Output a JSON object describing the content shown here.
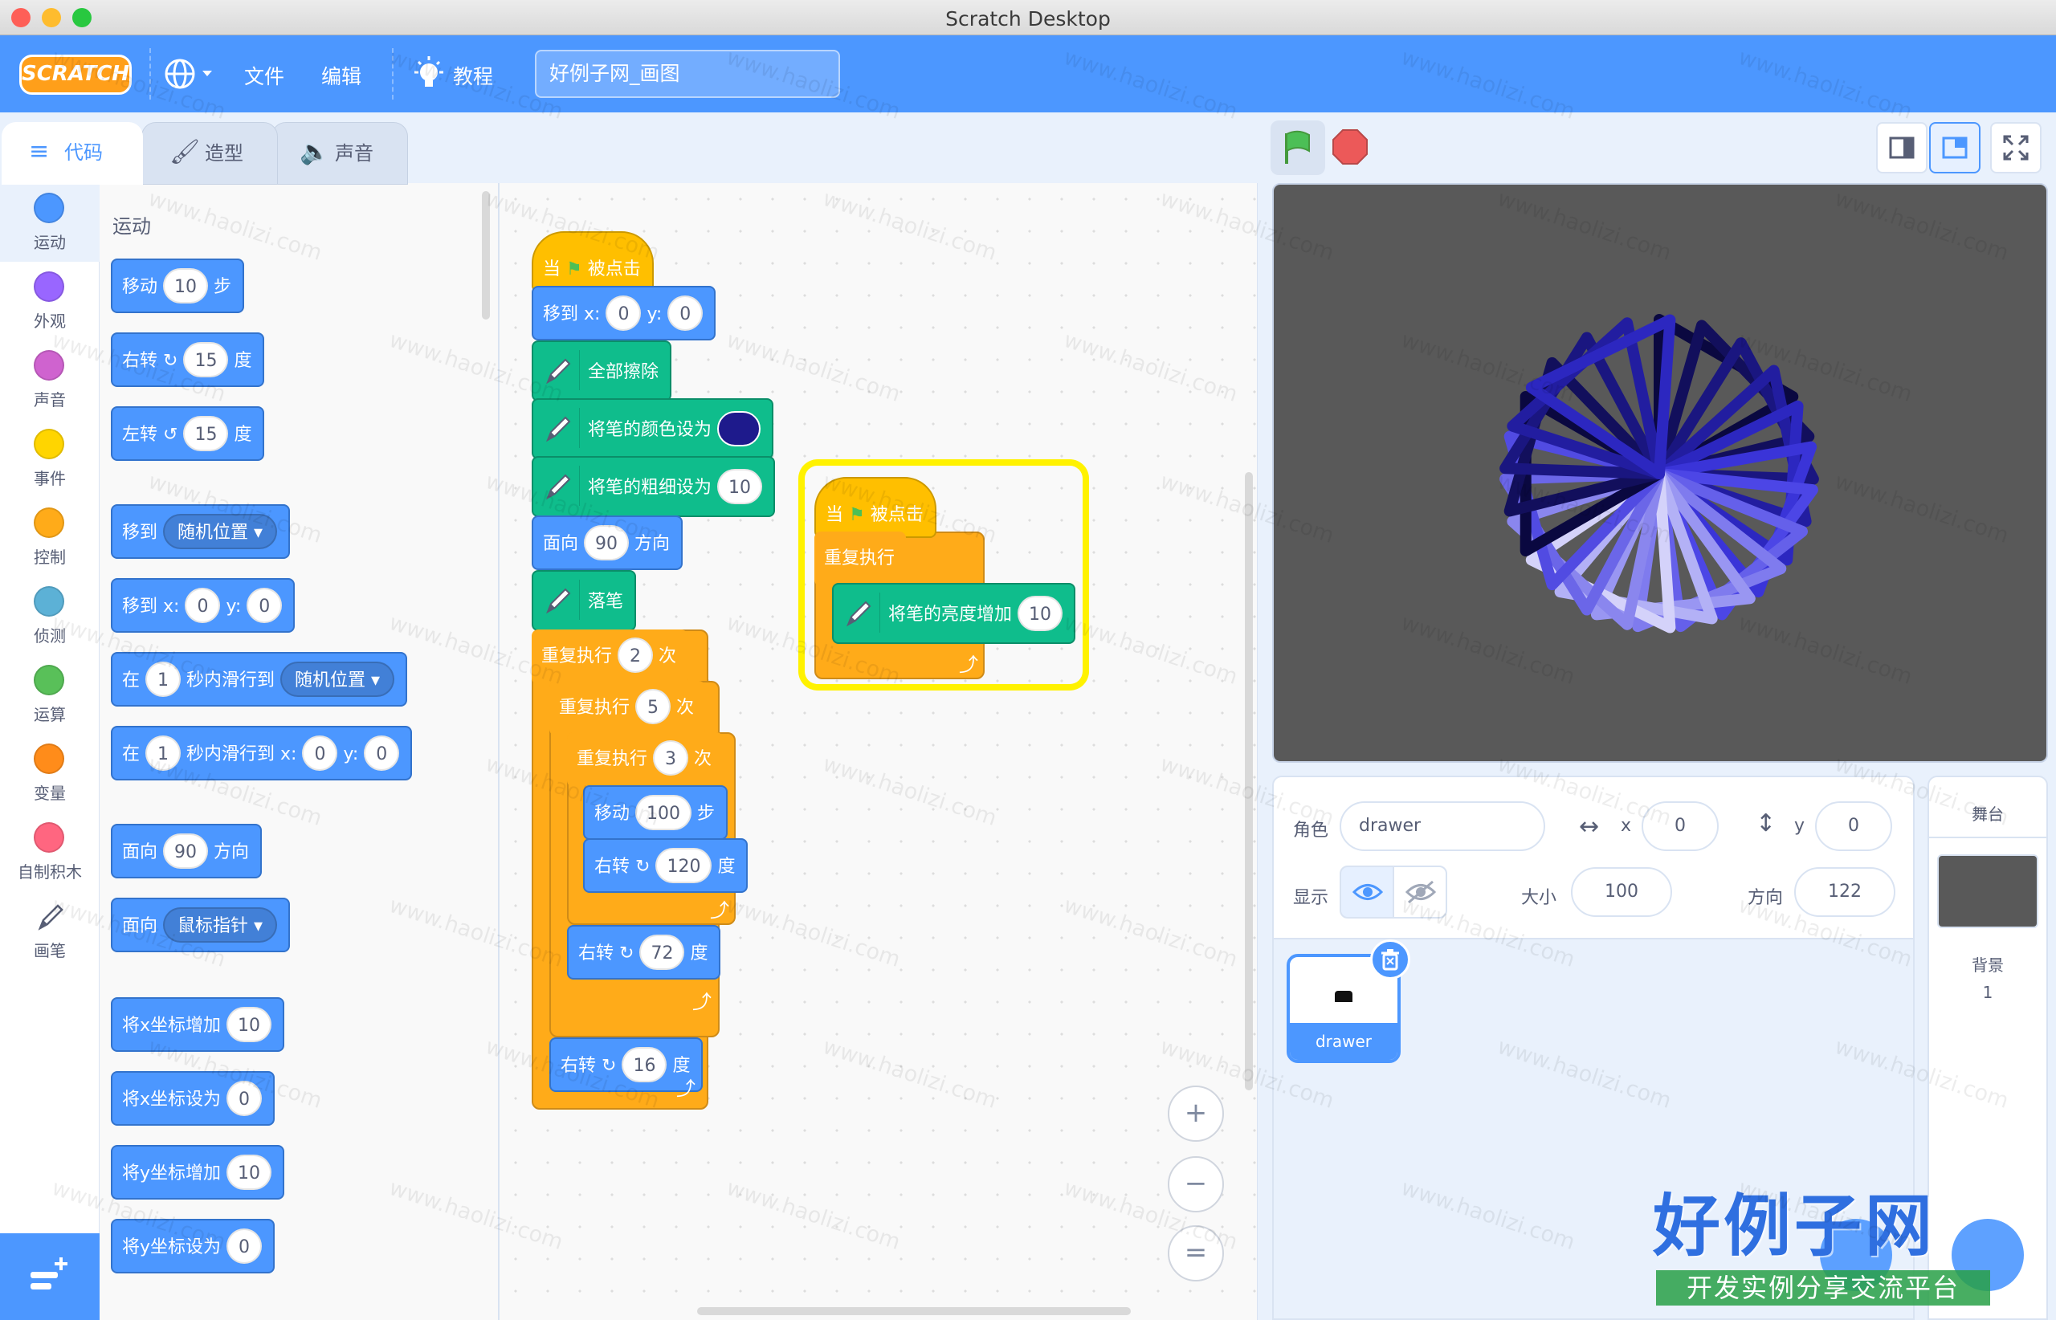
{
  "window_title": "Scratch Desktop",
  "menu": {
    "logo": "SCRATCH",
    "file": "文件",
    "edit": "编辑",
    "tutorials": "教程",
    "project_title": "好例子网_画图"
  },
  "tabs": {
    "code": "代码",
    "costumes": "造型",
    "sounds": "声音"
  },
  "categories": [
    {
      "label": "运动",
      "color": "#4c97ff"
    },
    {
      "label": "外观",
      "color": "#9966ff"
    },
    {
      "label": "声音",
      "color": "#cf63cf"
    },
    {
      "label": "事件",
      "color": "#ffd500"
    },
    {
      "label": "控制",
      "color": "#ffab19"
    },
    {
      "label": "侦测",
      "color": "#5cb1d6"
    },
    {
      "label": "运算",
      "color": "#59c059"
    },
    {
      "label": "变量",
      "color": "#ff8c1a"
    },
    {
      "label": "自制积木",
      "color": "#ff6680"
    },
    {
      "label": "画笔",
      "color": "#0fbd8c"
    }
  ],
  "palette": {
    "heading": "运动",
    "move": {
      "a": "移动",
      "v": "10",
      "b": "步"
    },
    "turn_right": {
      "a": "右转",
      "v": "15",
      "b": "度"
    },
    "turn_left": {
      "a": "左转",
      "v": "15",
      "b": "度"
    },
    "goto": {
      "a": "移到",
      "d": "随机位置"
    },
    "goto_xy": {
      "a": "移到 x:",
      "x": "0",
      "y_lbl": "y:",
      "y": "0"
    },
    "glide": {
      "a": "在",
      "v": "1",
      "b": "秒内滑行到",
      "d": "随机位置"
    },
    "glide_xy": {
      "a": "在",
      "v": "1",
      "b": "秒内滑行到 x:",
      "x": "0",
      "y_lbl": "y:",
      "y": "0"
    },
    "point_dir": {
      "a": "面向",
      "v": "90",
      "b": "方向"
    },
    "point_to": {
      "a": "面向",
      "d": "鼠标指针"
    },
    "change_x": {
      "a": "将x坐标增加",
      "v": "10"
    },
    "set_x": {
      "a": "将x坐标设为",
      "v": "0"
    },
    "change_y": {
      "a": "将y坐标增加",
      "v": "10"
    },
    "set_y": {
      "a": "将y坐标设为",
      "v": "0"
    }
  },
  "script1": {
    "hat": {
      "a": "当",
      "b": "被点击"
    },
    "goto": {
      "a": "移到 x:",
      "x": "0",
      "y_lbl": "y:",
      "y": "0"
    },
    "clear": "全部擦除",
    "set_color": {
      "a": "将笔的颜色设为",
      "color": "#1e1a8c"
    },
    "set_size": {
      "a": "将笔的粗细设为",
      "v": "10"
    },
    "face": {
      "a": "面向",
      "v": "90",
      "b": "方向"
    },
    "pen_down": "落笔",
    "rep1": {
      "a": "重复执行",
      "v": "2",
      "b": "次"
    },
    "rep2": {
      "a": "重复执行",
      "v": "5",
      "b": "次"
    },
    "rep3": {
      "a": "重复执行",
      "v": "3",
      "b": "次"
    },
    "move": {
      "a": "移动",
      "v": "100",
      "b": "步"
    },
    "turn1": {
      "a": "右转",
      "v": "120",
      "b": "度"
    },
    "turn2": {
      "a": "右转",
      "v": "72",
      "b": "度"
    },
    "turn3": {
      "a": "右转",
      "v": "16",
      "b": "度"
    }
  },
  "script2": {
    "hat": {
      "a": "当",
      "b": "被点击"
    },
    "forever": "重复执行",
    "change_bright": {
      "a": "将笔的亮度增加",
      "v": "10"
    }
  },
  "zoom": {
    "in": "+",
    "out": "−",
    "reset": "="
  },
  "sprite_info": {
    "sprite_label": "角色",
    "sprite_name": "drawer",
    "x_label": "x",
    "x": "0",
    "y_label": "y",
    "y": "0",
    "show_label": "显示",
    "size_label": "大小",
    "size": "100",
    "dir_label": "方向",
    "direction": "122"
  },
  "sprite_tile": {
    "name": "drawer"
  },
  "stage_panel": {
    "title": "舞台",
    "backdrops_label": "背景",
    "backdrops_count": "1"
  },
  "watermark": {
    "text": "www.haolizi.com",
    "brand": "好例子网",
    "slogan": "开发实例分享交流平台"
  }
}
